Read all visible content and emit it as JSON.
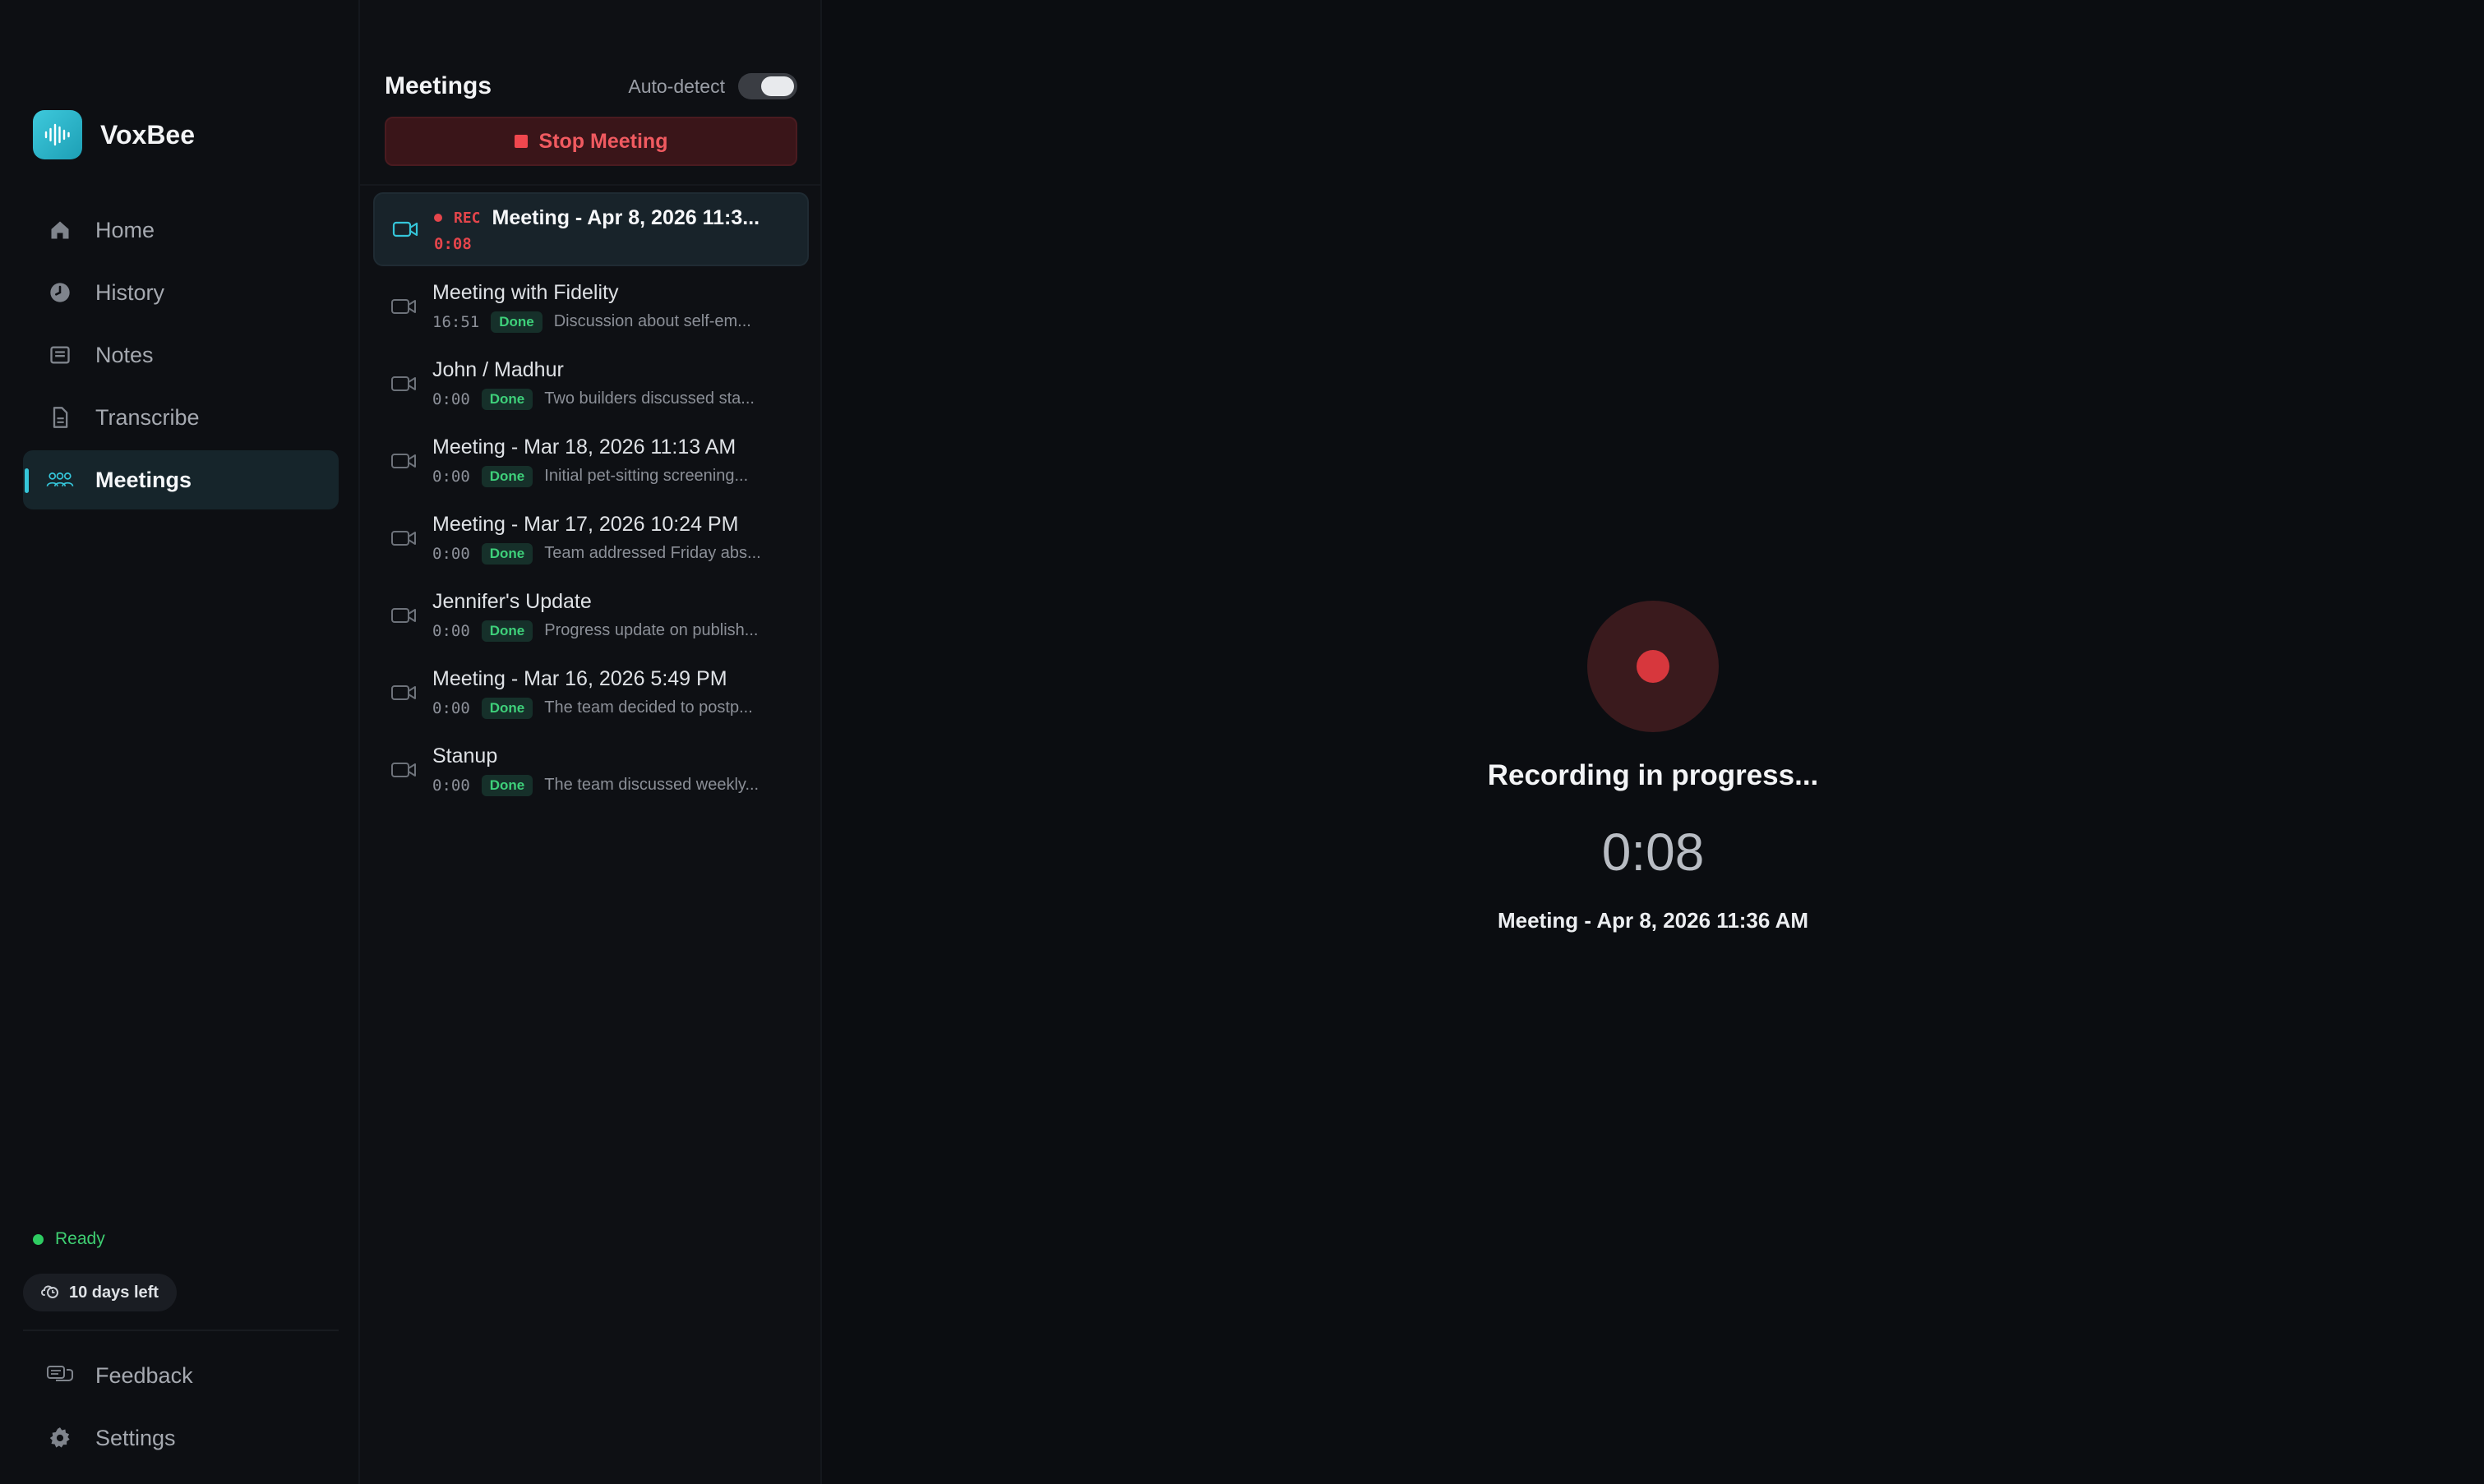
{
  "app": {
    "name": "VoxBee"
  },
  "nav": {
    "items": [
      {
        "label": "Home",
        "icon": "home-icon"
      },
      {
        "label": "History",
        "icon": "clock-icon"
      },
      {
        "label": "Notes",
        "icon": "notes-icon"
      },
      {
        "label": "Transcribe",
        "icon": "document-icon"
      },
      {
        "label": "Meetings",
        "icon": "people-icon",
        "active": true
      }
    ],
    "bottom": [
      {
        "label": "Feedback",
        "icon": "chat-icon"
      },
      {
        "label": "Settings",
        "icon": "gear-icon"
      }
    ]
  },
  "status": {
    "label": "Ready"
  },
  "trial": {
    "label": "10 days left"
  },
  "meetings_panel": {
    "title": "Meetings",
    "auto_detect_label": "Auto-detect",
    "stop_button_label": "Stop Meeting",
    "items": [
      {
        "title": "Meeting - Apr 8, 2026 11:3...",
        "rec": "REC",
        "duration": "0:08",
        "recording": true
      },
      {
        "title": "Meeting with Fidelity",
        "duration": "16:51",
        "badge": "Done",
        "summary": "Discussion about self-em..."
      },
      {
        "title": "John / Madhur",
        "duration": "0:00",
        "badge": "Done",
        "summary": "Two builders discussed sta..."
      },
      {
        "title": "Meeting - Mar 18, 2026 11:13 AM",
        "duration": "0:00",
        "badge": "Done",
        "summary": "Initial pet-sitting screening..."
      },
      {
        "title": "Meeting - Mar 17, 2026 10:24 PM",
        "duration": "0:00",
        "badge": "Done",
        "summary": "Team addressed Friday abs..."
      },
      {
        "title": "Jennifer's Update",
        "duration": "0:00",
        "badge": "Done",
        "summary": "Progress update on publish..."
      },
      {
        "title": "Meeting - Mar 16, 2026 5:49 PM",
        "duration": "0:00",
        "badge": "Done",
        "summary": "The team decided to postp..."
      },
      {
        "title": "Stanup",
        "duration": "0:00",
        "badge": "Done",
        "summary": "The team discussed weekly..."
      }
    ]
  },
  "recording": {
    "status_label": "Recording in progress...",
    "timer": "0:08",
    "meeting_name": "Meeting - Apr 8, 2026 11:36 AM"
  },
  "colors": {
    "accent": "#35c6da",
    "record_red": "#e4454b",
    "done_green": "#3ed07a"
  }
}
